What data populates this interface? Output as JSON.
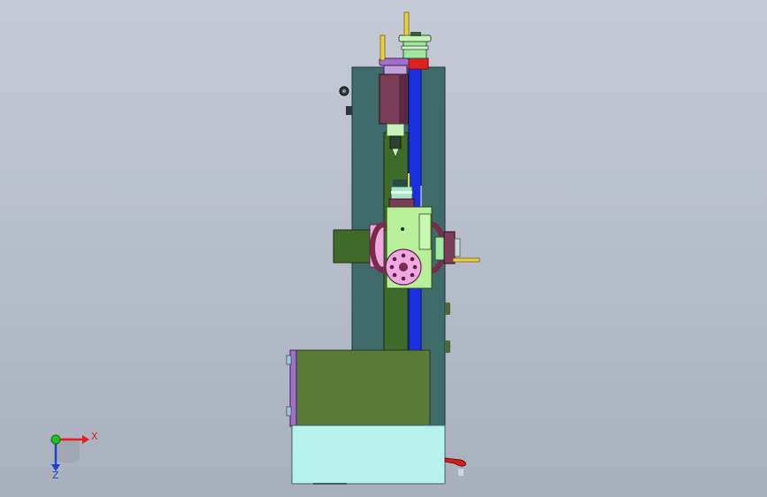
{
  "triad": {
    "x_label": "X",
    "z_label": "Z",
    "x_color": "#e02020",
    "y_color": "#20c020",
    "z_color": "#2040d0"
  },
  "colors": {
    "column": "#3e6a6a",
    "rail_green": "#3f6a2a",
    "rail_blue": "#1a2fe0",
    "motor_block": "#7a3c56",
    "head_block": "#b8f09a",
    "chuck": "#f0a8e0",
    "base_olive": "#5a7a38",
    "base_cyan": "#b8f2ee",
    "purple_plate": "#a070c8",
    "handle_yellow": "#e8d040",
    "red_block": "#e02020"
  }
}
